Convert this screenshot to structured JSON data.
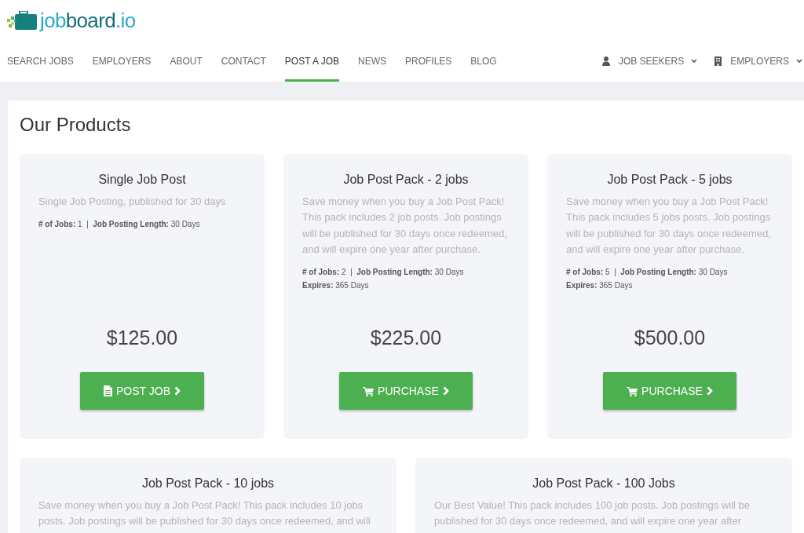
{
  "logo": {
    "parts": [
      "job",
      "board",
      ".io"
    ]
  },
  "nav": [
    {
      "label": "SEARCH JOBS",
      "selected": false
    },
    {
      "label": "EMPLOYERS",
      "selected": false
    },
    {
      "label": "ABOUT",
      "selected": false
    },
    {
      "label": "CONTACT",
      "selected": false
    },
    {
      "label": "POST A JOB",
      "selected": true
    },
    {
      "label": "NEWS",
      "selected": false
    },
    {
      "label": "PROFILES",
      "selected": false
    },
    {
      "label": "BLOG",
      "selected": false
    }
  ],
  "nav_right": [
    {
      "label": "JOB SEEKERS",
      "kind": "person"
    },
    {
      "label": "EMPLOYERS",
      "kind": "building"
    }
  ],
  "heading": "Our Products",
  "products": [
    {
      "title": "Single Job Post",
      "description": "Single Job Posting, published for 30 days",
      "details": [
        "**# of Jobs:** 1  |  **Job Posting Length:** 30 Days"
      ],
      "price": "$125.00",
      "button": {
        "label": "POST JOB",
        "kind": "post"
      }
    },
    {
      "title": "Job Post Pack - 2 jobs",
      "description": "Save money when you buy a Job Post Pack! This pack includes 2 job posts. Job postings will be published for 30 days once redeemed, and will expire one year after purchase.",
      "details": [
        "**# of Jobs:** 2  |  **Job Posting Length:** 30 Days",
        "**Expires:** 365 Days"
      ],
      "price": "$225.00",
      "button": {
        "label": "PURCHASE",
        "kind": "purchase"
      }
    },
    {
      "title": "Job Post Pack - 5 jobs",
      "description": "Save money when you buy a Job Post Pack! This pack includes 5 jobs posts. Job postings will be published for 30 days once redeemed, and will expire one year after purchase.",
      "details": [
        "**# of Jobs:** 5  |  **Job Posting Length:** 30 Days",
        "**Expires:** 365 Days"
      ],
      "price": "$500.00",
      "button": {
        "label": "PURCHASE",
        "kind": "purchase"
      }
    },
    {
      "title": "Job Post Pack - 10 jobs",
      "description": "Save money when you buy a Job Post Pack! This pack includes 10 jobs posts. Job postings will be published for 30 days once redeemed, and will"
    },
    {
      "title": "Job Post Pack - 100 Jobs",
      "description": "Our Best Value! This pack includes 100 job posts. Job postings will be published for 30 days once redeemed, and will expire one year after"
    }
  ]
}
